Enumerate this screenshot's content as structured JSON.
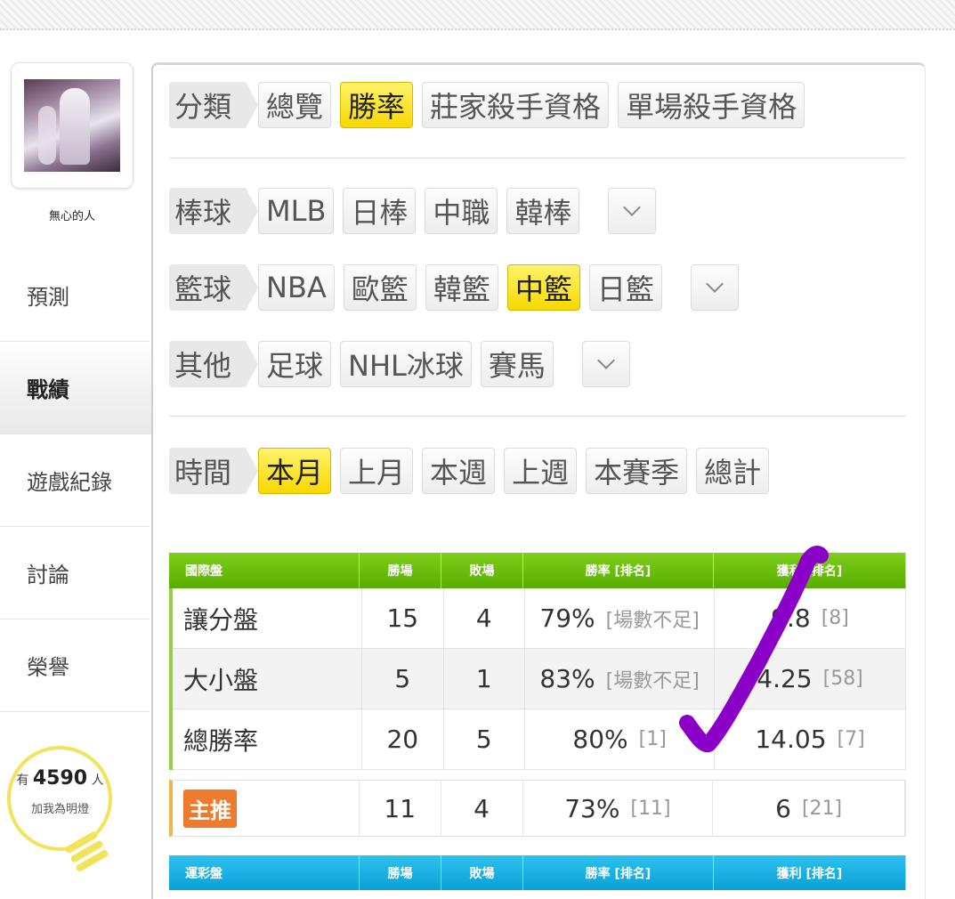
{
  "sidebar": {
    "username": "無心的人",
    "nav": [
      "預測",
      "戰績",
      "遊戲紀錄",
      "討論",
      "榮譽"
    ],
    "fans": {
      "prefix": "有",
      "count": "4590",
      "suffix": "人",
      "action": "加我為明燈"
    }
  },
  "filters": {
    "category": {
      "label": "分類",
      "options": [
        "總覽",
        "勝率",
        "莊家殺手資格",
        "單場殺手資格"
      ],
      "selected": "勝率"
    },
    "baseball": {
      "label": "棒球",
      "options": [
        "MLB",
        "日棒",
        "中職",
        "韓棒"
      ]
    },
    "basketball": {
      "label": "籃球",
      "options": [
        "NBA",
        "歐籃",
        "韓籃",
        "中籃",
        "日籃"
      ],
      "selected": "中籃"
    },
    "other": {
      "label": "其他",
      "options": [
        "足球",
        "NHL冰球",
        "賽馬"
      ]
    },
    "time": {
      "label": "時間",
      "options": [
        "本月",
        "上月",
        "本週",
        "上週",
        "本賽季",
        "總計"
      ],
      "selected": "本月"
    }
  },
  "intl_table": {
    "headers": [
      "國際盤",
      "勝場",
      "敗場",
      "勝率 [排名]",
      "獲利 [排名]"
    ],
    "rows": [
      {
        "name": "讓分盤",
        "win": "15",
        "lose": "4",
        "rate": "79%",
        "rate_rank": "[場數不足]",
        "profit": "9.8",
        "profit_rank": "[8]"
      },
      {
        "name": "大小盤",
        "win": "5",
        "lose": "1",
        "rate": "83%",
        "rate_rank": "[場數不足]",
        "profit": "4.25",
        "profit_rank": "[58]"
      },
      {
        "name": "總勝率",
        "win": "20",
        "lose": "5",
        "rate": "80%",
        "rate_rank": "[1]",
        "profit": "14.05",
        "profit_rank": "[7]"
      }
    ],
    "main_pick": {
      "badge": "主推",
      "win": "11",
      "lose": "4",
      "rate": "73%",
      "rate_rank": "[11]",
      "profit": "6",
      "profit_rank": "[21]"
    }
  },
  "lottery_table": {
    "headers": [
      "運彩盤",
      "勝場",
      "敗場",
      "勝率 [排名]",
      "獲利 [排名]"
    ]
  },
  "colors": {
    "selected": "#f7d800",
    "green_header": "#58ad00",
    "blue_header": "#0aa1d7",
    "checkmark": "#8a00c8"
  }
}
